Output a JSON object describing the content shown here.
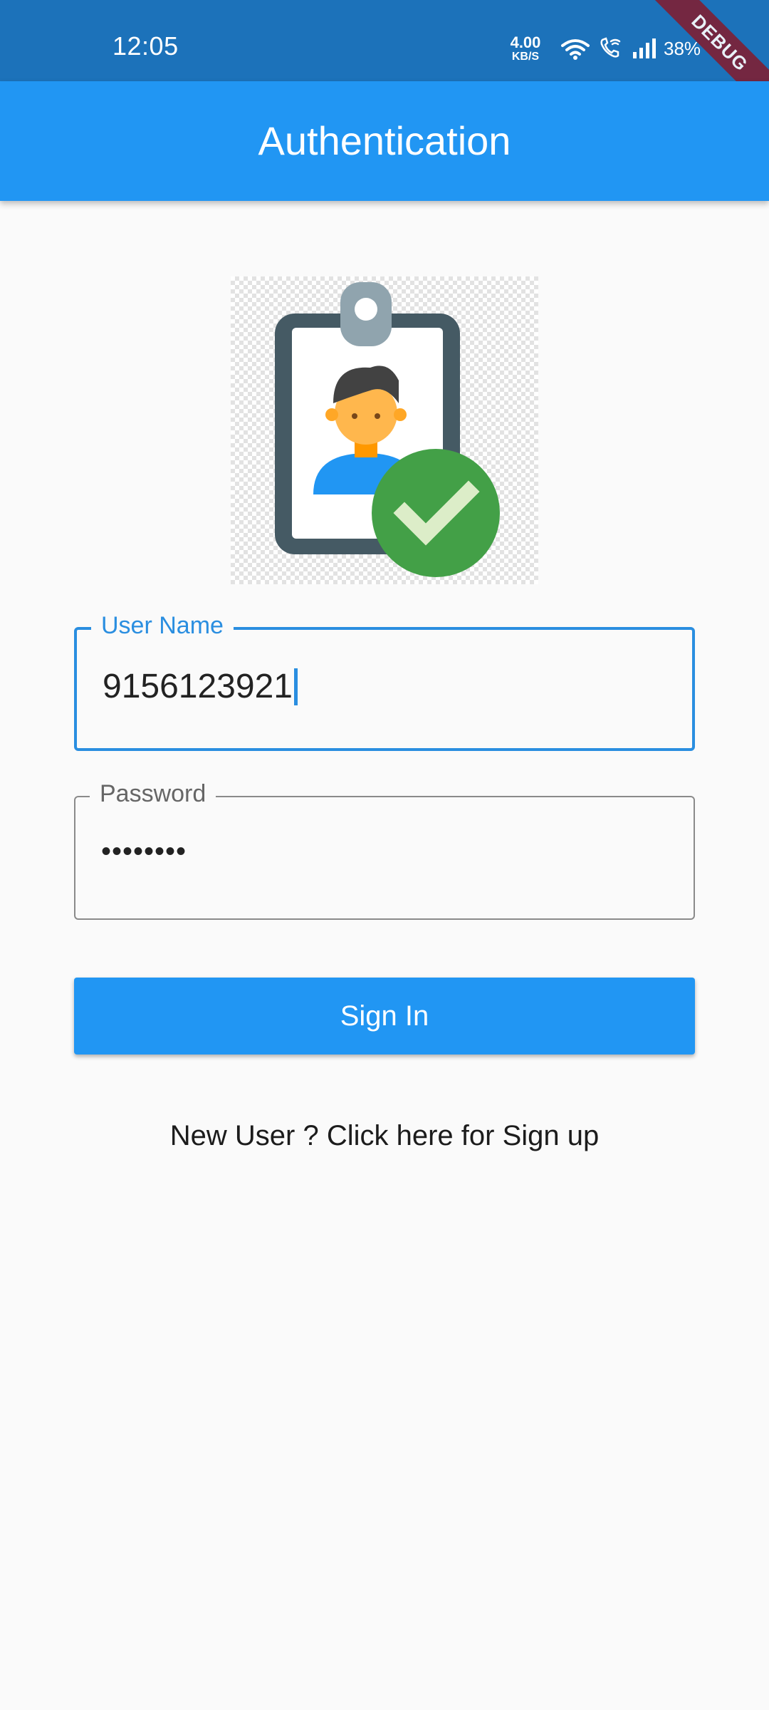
{
  "status_bar": {
    "time": "12:05",
    "net_speed_value": "4.00",
    "net_speed_unit": "KB/S",
    "battery": "38%",
    "icons": [
      "wifi-icon",
      "wifi-call-icon",
      "signal-icon"
    ]
  },
  "debug_banner": "DEBUG",
  "app_bar": {
    "title": "Authentication"
  },
  "logo": {
    "icon": "id-badge-verified-icon"
  },
  "form": {
    "username": {
      "label": "User Name",
      "value": "9156123921",
      "focused": true
    },
    "password": {
      "label": "Password",
      "value": "••••••••"
    },
    "signin_label": "Sign In",
    "signup_text": "New User ? Click here for Sign up"
  },
  "colors": {
    "status_bar": "#1c72ba",
    "primary": "#2196f3",
    "focus": "#2a8ee0",
    "background": "#fafafa",
    "debug_ribbon": "#7e1f35"
  }
}
